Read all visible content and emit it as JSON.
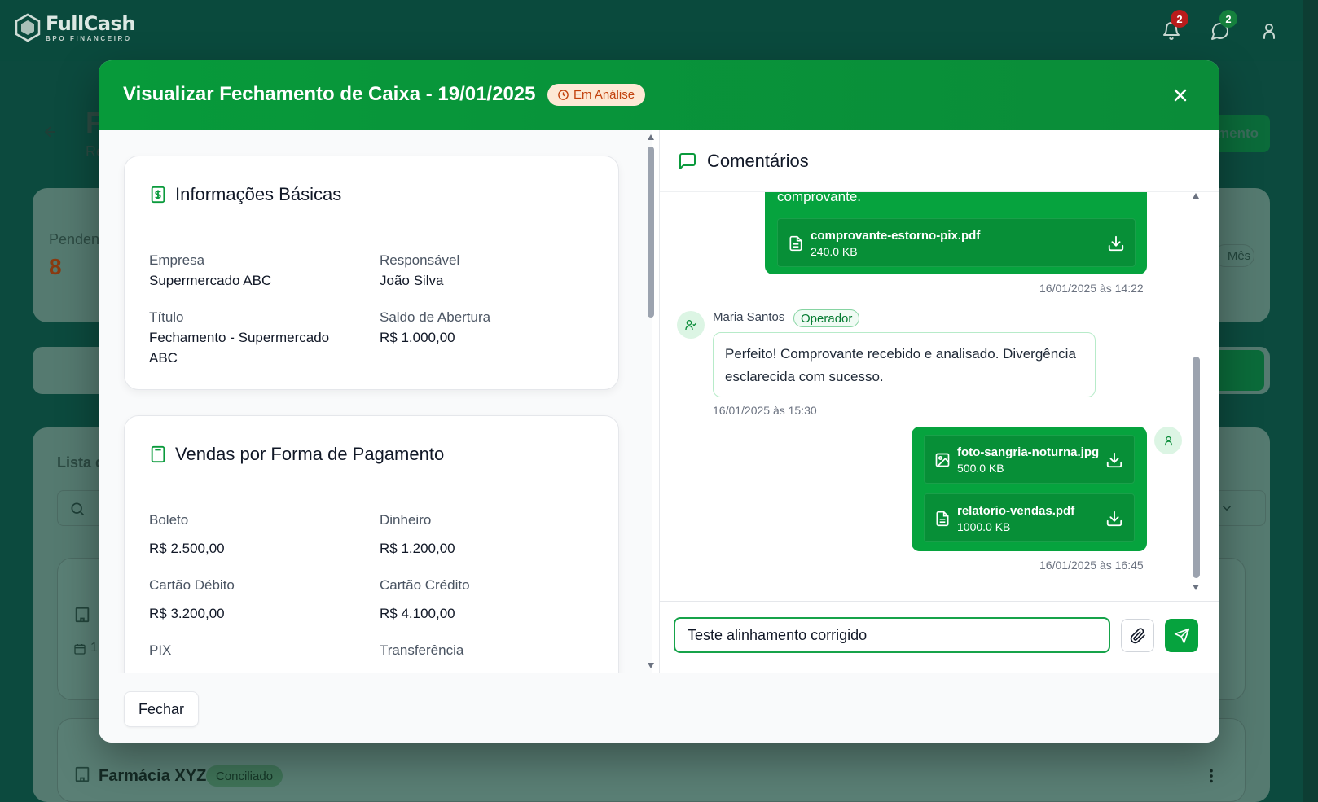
{
  "app": {
    "logo_name": "FullCash",
    "logo_sub": "BPO FINANCEIRO",
    "notifications_count": "2",
    "messages_count": "2"
  },
  "background": {
    "page_title_fragment": "F",
    "page_subtitle_fragment": "Re",
    "new_button_fragment": "mento",
    "pending_label": "Pendent",
    "pending_value": "8",
    "period_chip": "Mês",
    "list_title_fragment": "Lista d",
    "row_icon_fragment": "1",
    "company_card_name": "Farmácia XYZ",
    "company_card_status": "Conciliado"
  },
  "modal": {
    "title": "Visualizar Fechamento de Caixa - 19/01/2025",
    "status": "Em Análise",
    "basic_info": {
      "heading": "Informações Básicas",
      "fields": [
        {
          "label": "Empresa",
          "value": "Supermercado ABC"
        },
        {
          "label": "Responsável",
          "value": "João Silva"
        },
        {
          "label": "Título",
          "value": "Fechamento - Supermercado ABC"
        },
        {
          "label": "Saldo de Abertura",
          "value": "R$ 1.000,00"
        }
      ]
    },
    "sales": {
      "heading": "Vendas por Forma de Pagamento",
      "fields": [
        {
          "label": "Boleto",
          "value": "R$ 2.500,00"
        },
        {
          "label": "Dinheiro",
          "value": "R$ 1.200,00"
        },
        {
          "label": "Cartão Débito",
          "value": "R$ 3.200,00"
        },
        {
          "label": "Cartão Crédito",
          "value": "R$ 4.100,00"
        },
        {
          "label": "PIX",
          "value": ""
        },
        {
          "label": "Transferência",
          "value": ""
        }
      ]
    },
    "comments": {
      "heading": "Comentários",
      "messages": [
        {
          "text_tail": "comprovante.",
          "files": [
            {
              "name": "comprovante-estorno-pix.pdf",
              "size": "240.0 KB"
            }
          ],
          "time": "16/01/2025 às 14:22"
        },
        {
          "author": "Maria Santos",
          "role": "Operador",
          "text": "Perfeito! Comprovante recebido e analisado. Divergência esclarecida com sucesso.",
          "time": "16/01/2025 às 15:30"
        },
        {
          "files": [
            {
              "name": "foto-sangria-noturna.jpg",
              "size": "500.0 KB"
            },
            {
              "name": "relatorio-vendas.pdf",
              "size": "1000.0 KB"
            }
          ],
          "time": "16/01/2025 às 16:45"
        }
      ],
      "input_value": "Teste alinhamento corrigido"
    },
    "footer_close": "Fechar"
  }
}
